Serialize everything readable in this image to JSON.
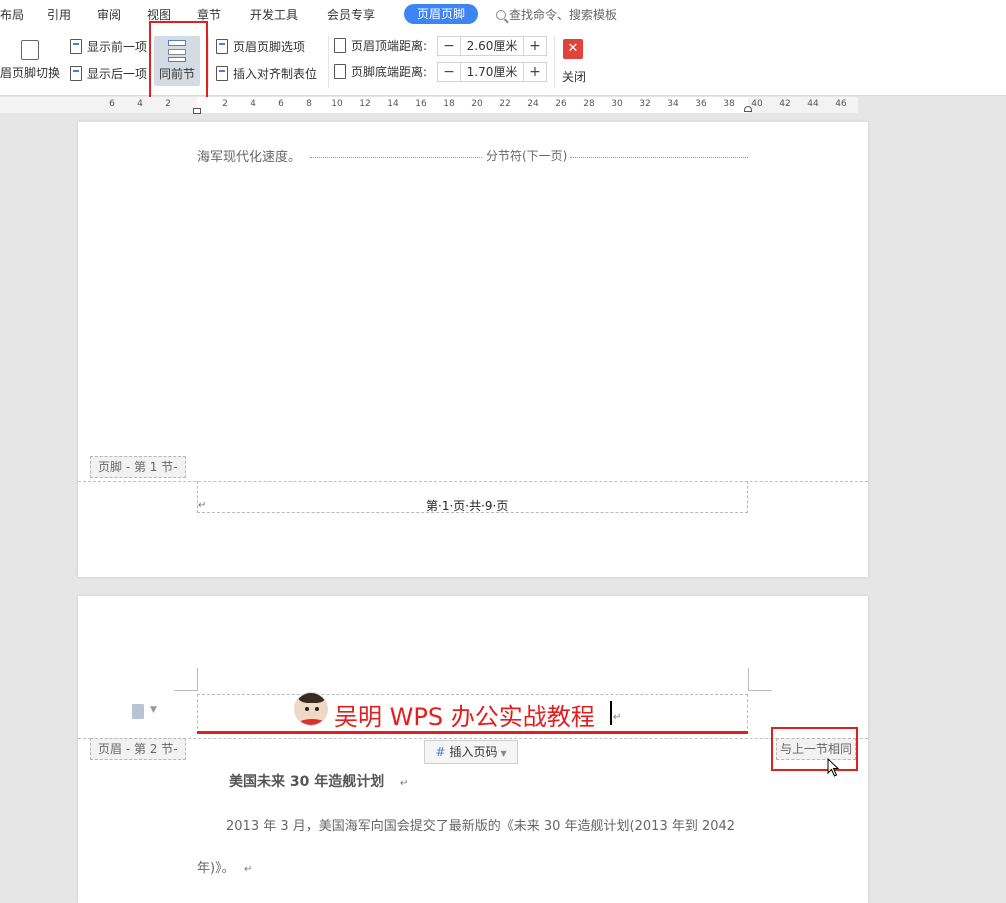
{
  "menu": {
    "items": [
      "布局",
      "引用",
      "审阅",
      "视图",
      "章节",
      "开发工具",
      "会员专享"
    ],
    "active_tab": "页眉页脚",
    "search_placeholder": "查找命令、搜索模板"
  },
  "ribbon": {
    "header_footer_switch": "眉页脚切换",
    "show_previous": "显示前一项",
    "show_next": "显示后一项",
    "same_as_previous": "同前节",
    "header_footer_options": "页眉页脚选项",
    "insert_align_tab": "插入对齐制表位",
    "header_top_distance_label": "页眉顶端距离:",
    "header_top_distance_value": "2.60厘米",
    "footer_bottom_distance_label": "页脚底端距离:",
    "footer_bottom_distance_value": "1.70厘米",
    "close_label": "关闭",
    "minus": "−",
    "plus": "+"
  },
  "ruler": {
    "ticks": [
      "6",
      "4",
      "2",
      "2",
      "4",
      "6",
      "8",
      "10",
      "12",
      "14",
      "16",
      "18",
      "20",
      "22",
      "24",
      "26",
      "28",
      "30",
      "32",
      "34",
      "36",
      "38",
      "40",
      "42",
      "44",
      "46"
    ]
  },
  "page1": {
    "body_text": "海军现代化速度。",
    "section_break": "分节符(下一页)",
    "footer_tag": "页脚 - 第 1 节-",
    "footer_text": "第·1·页·共·9·页",
    "return_mark": "↵"
  },
  "page2": {
    "header_text": "吴明 WPS 办公实战教程",
    "header_tag": "页眉 - 第 2 节-",
    "insert_page_number": "插入页码",
    "same_as_previous_tag": "与上一节相同",
    "heading": "美国未来 30 年造舰计划",
    "para1_line1": "2013 年 3 月，美国海军向国会提交了最新版的《未来 30 年造舰计划(2013 年到 2042",
    "para1_line2": "年)》。",
    "return_mark": "↵"
  },
  "colors": {
    "accent": "#3d84f4",
    "highlight_box": "#e0201f",
    "header_title": "#e0201f"
  }
}
